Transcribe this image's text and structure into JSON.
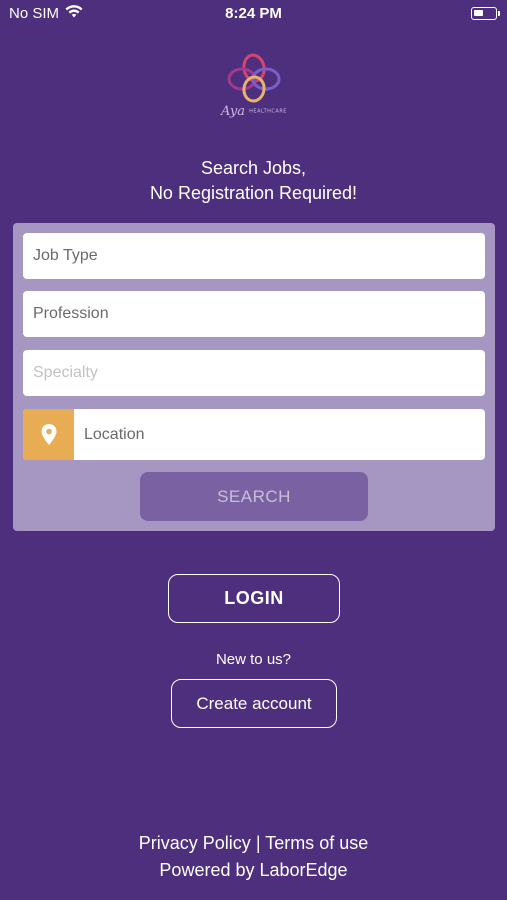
{
  "status_bar": {
    "carrier": "No SIM",
    "time": "8:24 PM"
  },
  "logo": {
    "script_text": "Aya",
    "small_text": "HEALTHCARE"
  },
  "headline": {
    "line1": "Search Jobs,",
    "line2": "No Registration Required!"
  },
  "search_form": {
    "job_type_placeholder": "Job Type",
    "profession_placeholder": "Profession",
    "specialty_placeholder": "Specialty",
    "location_placeholder": "Location",
    "search_label": "SEARCH"
  },
  "auth": {
    "login_label": "LOGIN",
    "new_to_us": "New to us?",
    "create_account_label": "Create account"
  },
  "footer": {
    "privacy": "Privacy Policy",
    "separator": "|",
    "terms": "Terms of use",
    "powered_by": "Powered by LaborEdge"
  },
  "colors": {
    "background": "#4e2f7d",
    "panel": "#a596c2",
    "location_accent": "#e8ad54",
    "search_button": "#7a62a2"
  },
  "icons": [
    "wifi-icon",
    "battery-icon",
    "logo-icon",
    "location-pin-icon"
  ]
}
